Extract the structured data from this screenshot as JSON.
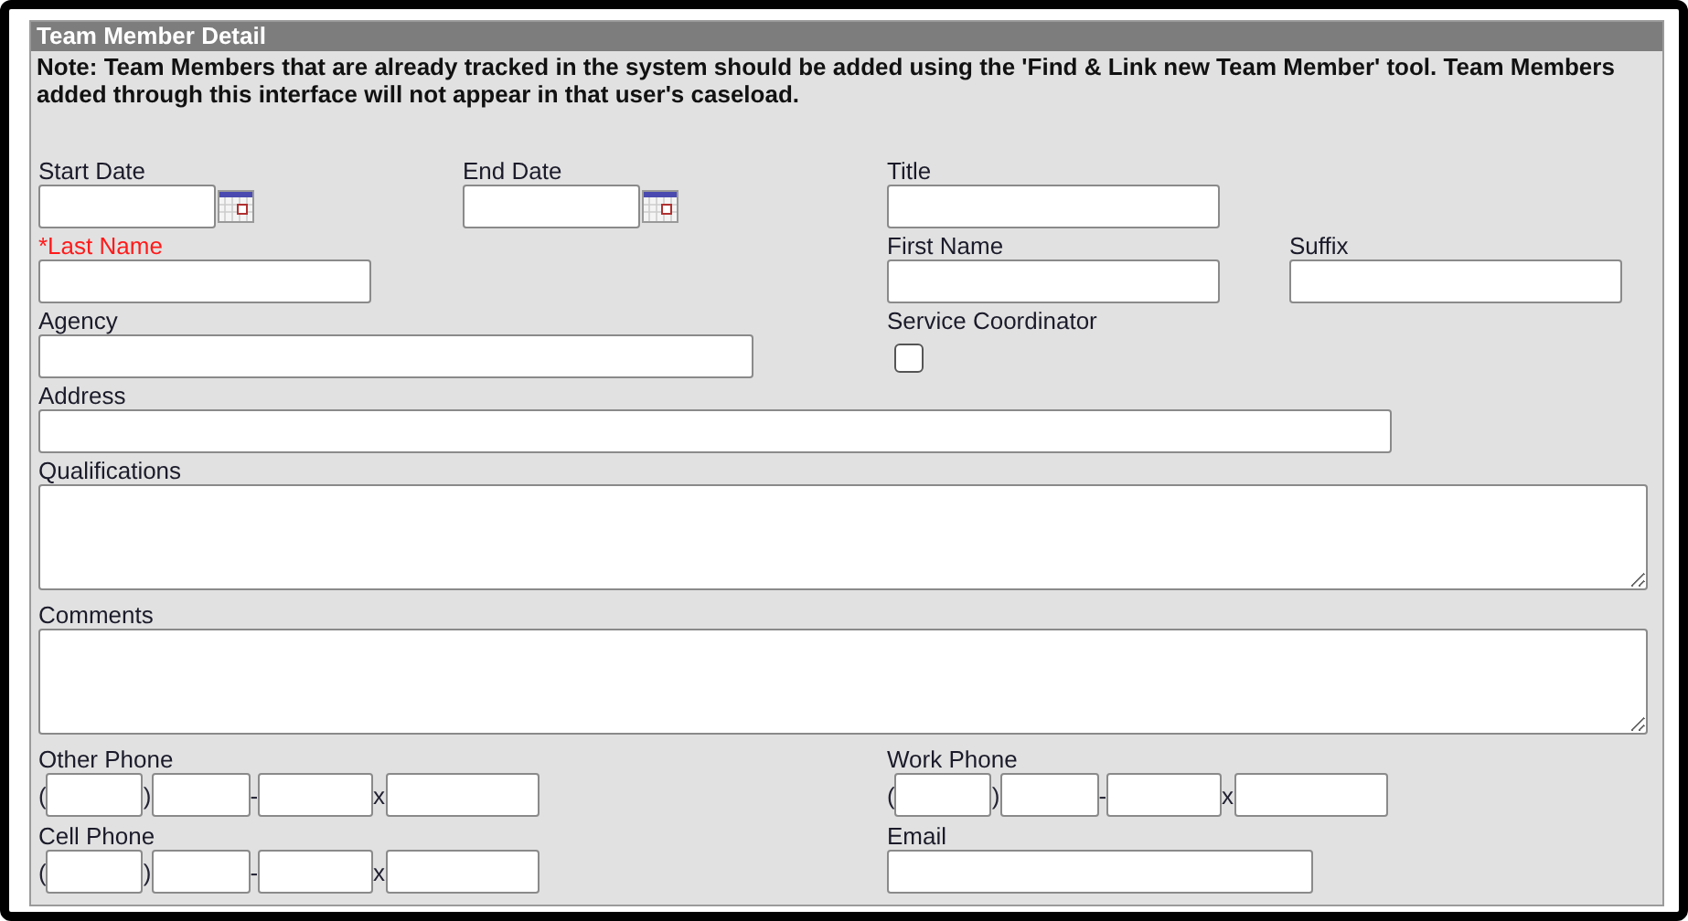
{
  "panel": {
    "title": "Team Member Detail",
    "note": "Note: Team Members that are already tracked in the system should be added using the 'Find & Link new Team Member' tool. Team Members added through this interface will not appear in that user's caseload."
  },
  "rows": [
    [
      {
        "kind": "date",
        "label": "Start Date",
        "required": false
      },
      {
        "kind": "date",
        "label": "End Date",
        "required": false
      },
      {
        "kind": "text",
        "label": "Title",
        "required": false
      }
    ],
    [
      {
        "kind": "text",
        "label": "*Last Name",
        "required": true
      },
      {
        "kind": "text",
        "label": "First Name",
        "required": false
      },
      {
        "kind": "text",
        "label": "Suffix",
        "required": false
      }
    ],
    [
      {
        "kind": "wide",
        "label": "Agency",
        "required": false
      },
      {
        "kind": "checkbox",
        "label": "Service Coordinator",
        "required": false,
        "checked": false
      }
    ],
    [
      {
        "kind": "long",
        "label": "Address",
        "required": false
      }
    ],
    [
      {
        "kind": "textarea",
        "label": "Qualifications",
        "required": false
      }
    ],
    [
      {
        "kind": "textarea",
        "label": "Comments",
        "required": false
      }
    ],
    [
      {
        "kind": "phone",
        "label": "Other Phone",
        "required": false,
        "separators": [
          "(",
          ")",
          "-",
          "x"
        ]
      },
      {
        "kind": "phone",
        "label": "Work Phone",
        "required": false,
        "separators": [
          "(",
          ")",
          "-",
          "x"
        ]
      }
    ],
    [
      {
        "kind": "phone",
        "label": "Cell Phone",
        "required": false,
        "separators": [
          "(",
          ")",
          "-",
          "x"
        ]
      },
      {
        "kind": "email",
        "label": "Email",
        "required": false
      }
    ]
  ]
}
